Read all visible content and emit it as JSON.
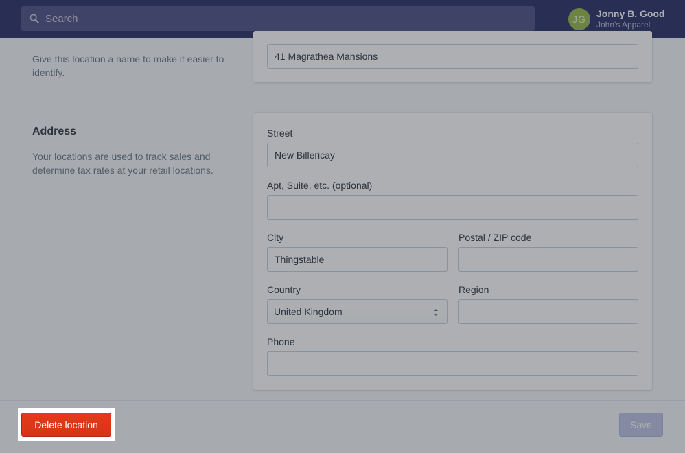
{
  "topbar": {
    "search_placeholder": "Search",
    "user": {
      "initials": "JG",
      "name": "Jonny B. Good",
      "shop": "John's Apparel"
    }
  },
  "location_name": {
    "description": "Give this location a name to make it easier to identify.",
    "value": "41 Magrathea Mansions"
  },
  "address": {
    "heading": "Address",
    "description": "Your locations are used to track sales and determine tax rates at your retail locations.",
    "street_label": "Street",
    "street_value": "New Billericay",
    "apt_label": "Apt, Suite, etc. (optional)",
    "apt_value": "",
    "city_label": "City",
    "city_value": "Thingstable",
    "postal_label": "Postal / ZIP code",
    "postal_value": "",
    "country_label": "Country",
    "country_value": "United Kingdom",
    "region_label": "Region",
    "region_value": "",
    "phone_label": "Phone",
    "phone_value": ""
  },
  "footer": {
    "delete_label": "Delete location",
    "save_label": "Save"
  },
  "colors": {
    "topbar": "#1c2260",
    "delete": "#de3618",
    "save_disabled": "#bac0e6"
  }
}
